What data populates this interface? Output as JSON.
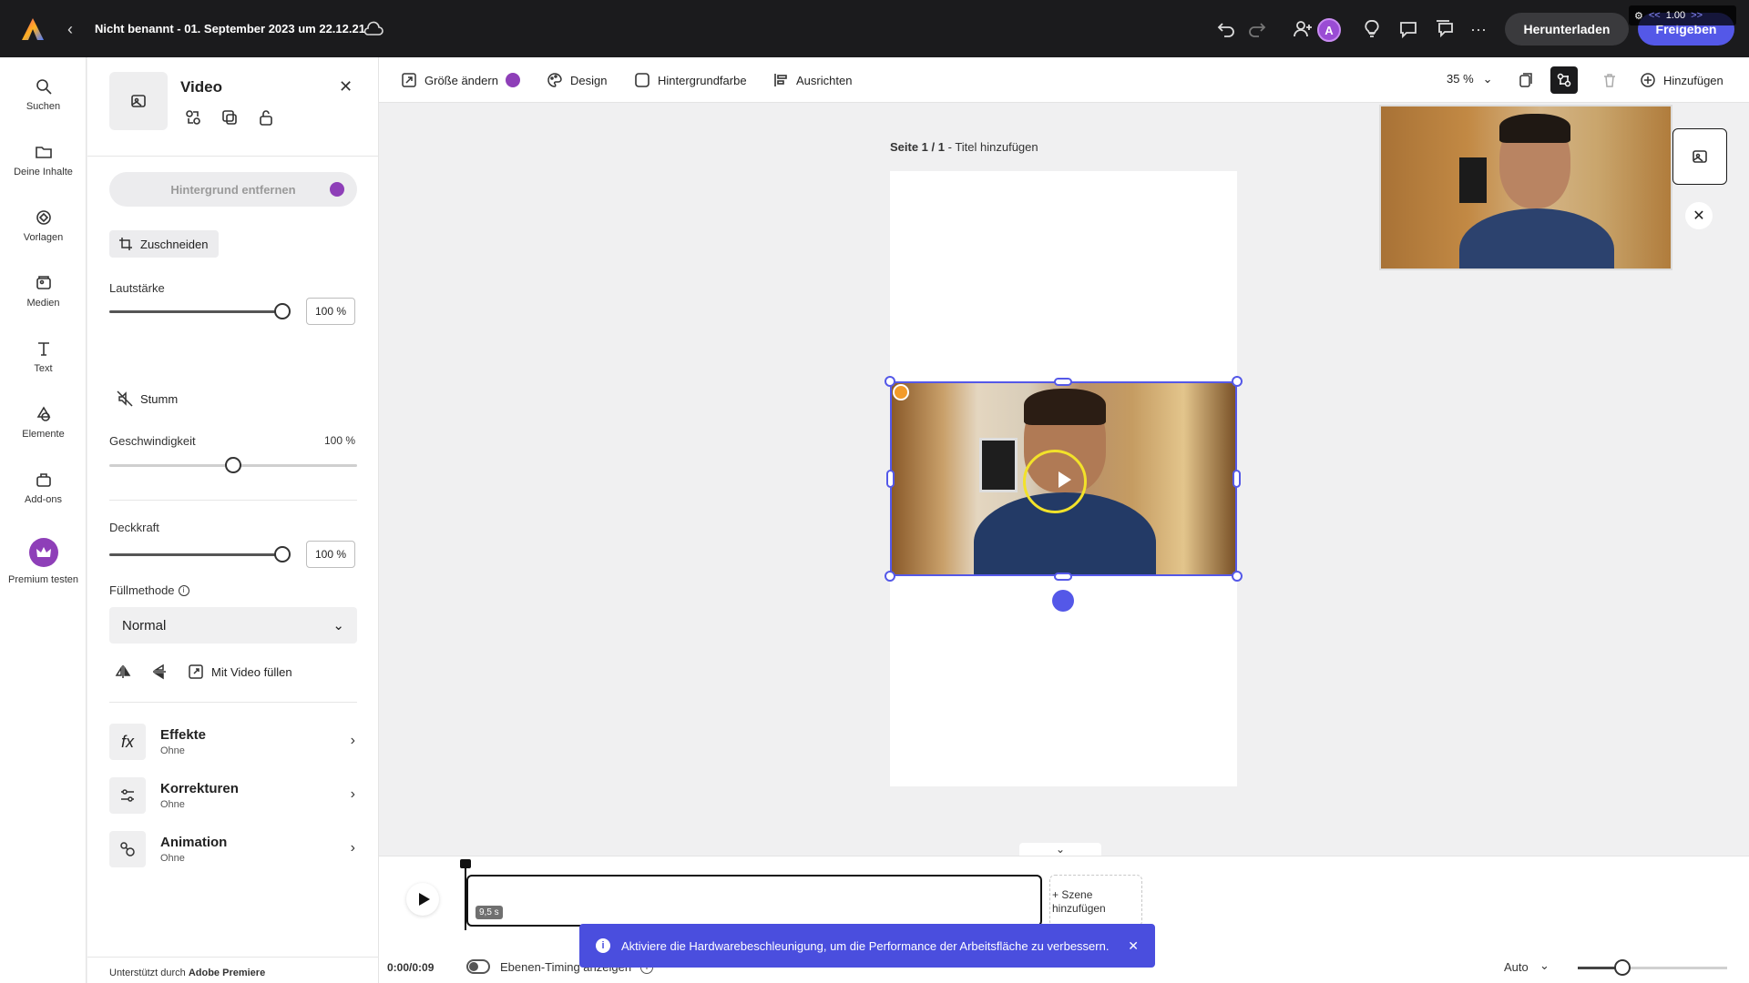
{
  "topbar": {
    "title": "Nicht benannt - 01. September 2023 um 22.12.21",
    "download_label": "Herunterladen",
    "share_label": "Freigeben",
    "avatar_letter": "A",
    "speed_overlay": {
      "back": "<<",
      "value": "1.00",
      "forward": ">>"
    }
  },
  "rail": {
    "items": [
      {
        "label": "Suchen",
        "icon": "search-icon"
      },
      {
        "label": "Deine Inhalte",
        "icon": "folder-icon"
      },
      {
        "label": "Vorlagen",
        "icon": "templates-icon"
      },
      {
        "label": "Medien",
        "icon": "media-icon"
      },
      {
        "label": "Text",
        "icon": "text-icon"
      },
      {
        "label": "Elemente",
        "icon": "shapes-icon"
      },
      {
        "label": "Add-ons",
        "icon": "addons-icon"
      },
      {
        "label": "Premium testen",
        "icon": "crown-icon"
      }
    ]
  },
  "panel": {
    "title": "Video",
    "remove_bg_label": "Hintergrund entfernen",
    "crop_label": "Zuschneiden",
    "volume": {
      "label": "Lautstärke",
      "value": "100 %",
      "level": 1.0
    },
    "mute_label": "Stumm",
    "speed": {
      "label": "Geschwindigkeit",
      "value": "100 %",
      "level": 0.5
    },
    "opacity": {
      "label": "Deckkraft",
      "value": "100 %",
      "level": 1.0
    },
    "blend": {
      "label": "Füllmethode",
      "value": "Normal"
    },
    "fill_video_label": "Mit Video füllen",
    "sections": [
      {
        "title": "Effekte",
        "subtitle": "Ohne"
      },
      {
        "title": "Korrekturen",
        "subtitle": "Ohne"
      },
      {
        "title": "Animation",
        "subtitle": "Ohne"
      }
    ],
    "credit_prefix": "Unterstützt durch",
    "credit_brand": "Adobe Premiere"
  },
  "ctxbar": {
    "resize_label": "Größe ändern",
    "design_label": "Design",
    "bgcolor_label": "Hintergrundfarbe",
    "align_label": "Ausrichten",
    "zoom_value": "35 %",
    "add_label": "Hinzufügen"
  },
  "canvas": {
    "page_prefix": "Seite 1 / 1",
    "page_title": "Titel hinzufügen"
  },
  "timeline": {
    "clip_duration": "9,5 s",
    "add_scene_label": "+ Szene hinzufügen",
    "time": "0:00/0:09",
    "layer_timing_label": "Ebenen-Timing anzeigen",
    "auto_label": "Auto",
    "zoom_level": 0.3
  },
  "toast": {
    "message": "Aktiviere die Hardwarebeschleunigung, um die Performance der Arbeitsfläche zu verbessern."
  },
  "colors": {
    "accent": "#5458e8",
    "premium": "#8e3fb8",
    "topbar": "#1b1b1d"
  }
}
